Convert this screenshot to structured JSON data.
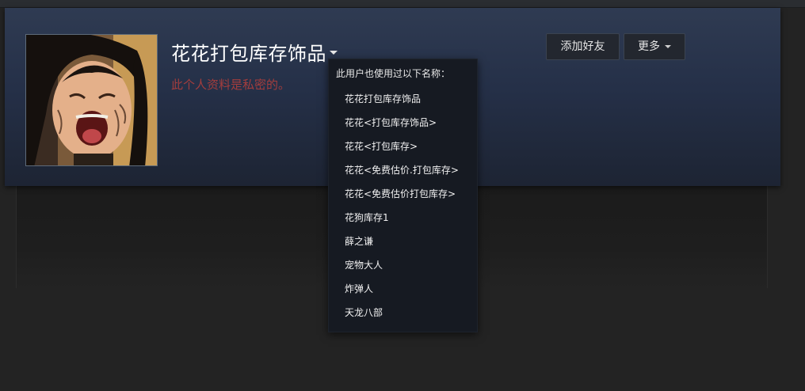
{
  "profile": {
    "persona_name": "花花打包库存饰品",
    "private_notice": "此个人资料是私密的。",
    "avatar_icon": "user-avatar-photo"
  },
  "actions": {
    "add_friend_label": "添加好友",
    "more_label": "更多"
  },
  "alias_popup": {
    "title": "此用户也使用过以下名称：",
    "aliases": [
      "花花打包库存饰品",
      "花花<打包库存饰品>",
      "花花<打包库存>",
      "花花<免费估价.打包库存>",
      "花花<免费估价打包库存>",
      "花狗库存1",
      "薛之谦",
      "宠物大人",
      "炸弹人",
      "天龙八部"
    ]
  },
  "colors": {
    "header_bg": "#253048",
    "private_text": "#a33d3d",
    "popup_bg": "#161a22"
  }
}
